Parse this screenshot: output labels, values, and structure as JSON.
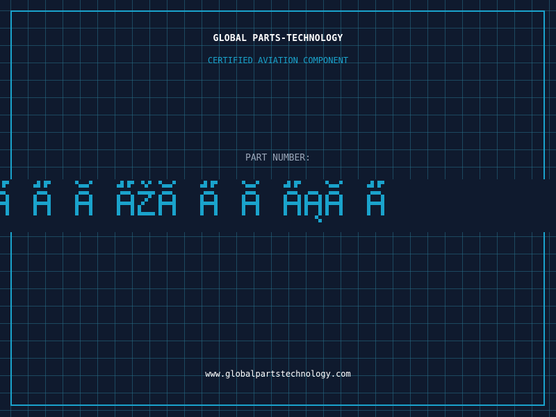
{
  "header": {
    "company": "GLOBAL PARTS-TECHNOLOGY",
    "tagline": "CERTIFIED AVIATION COMPONENT"
  },
  "part": {
    "label": "PART NUMBER:",
    "value": "Ã Ã Ă ÃŽĂ Ã Ă ÃĄĂ Ã"
  },
  "footer": {
    "url": "www.globalpartstechnology.com"
  },
  "colors": {
    "background": "#0f1a2e",
    "accent": "#1aa3cc",
    "title": "#ffffff",
    "label": "#9aa6b8"
  }
}
